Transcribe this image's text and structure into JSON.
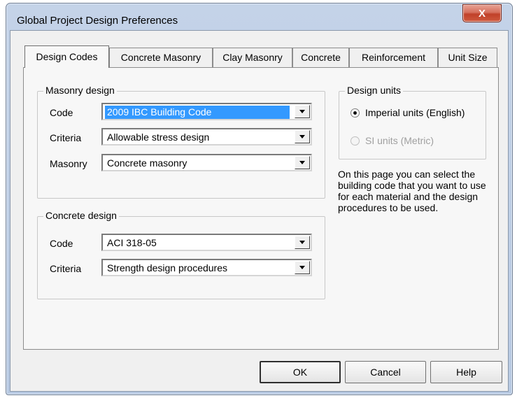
{
  "window": {
    "title": "Global Project Design Preferences",
    "close_glyph": "X"
  },
  "tabs": [
    {
      "label": "Design Codes",
      "active": true
    },
    {
      "label": "Concrete Masonry",
      "active": false
    },
    {
      "label": "Clay Masonry",
      "active": false
    },
    {
      "label": "Concrete",
      "active": false
    },
    {
      "label": "Reinforcement",
      "active": false
    },
    {
      "label": "Unit Size",
      "active": false
    }
  ],
  "masonry_design": {
    "legend": "Masonry design",
    "code_label": "Code",
    "code_value": "2009 IBC Building Code",
    "criteria_label": "Criteria",
    "criteria_value": "Allowable stress design",
    "masonry_label": "Masonry",
    "masonry_value": "Concrete masonry"
  },
  "concrete_design": {
    "legend": "Concrete design",
    "code_label": "Code",
    "code_value": "ACI 318-05",
    "criteria_label": "Criteria",
    "criteria_value": "Strength design procedures"
  },
  "design_units": {
    "legend": "Design units",
    "imperial_label": "Imperial units (English)",
    "imperial_checked": true,
    "si_label": "SI units (Metric)",
    "si_enabled": false
  },
  "info_text": "On this page you can select the building code that you want to use for each material and the design procedures to be used.",
  "buttons": {
    "ok": "OK",
    "cancel": "Cancel",
    "help": "Help"
  },
  "colors": {
    "selection": "#3399ff",
    "close_button": "#c7432c",
    "frame": "#b9cbe4"
  }
}
